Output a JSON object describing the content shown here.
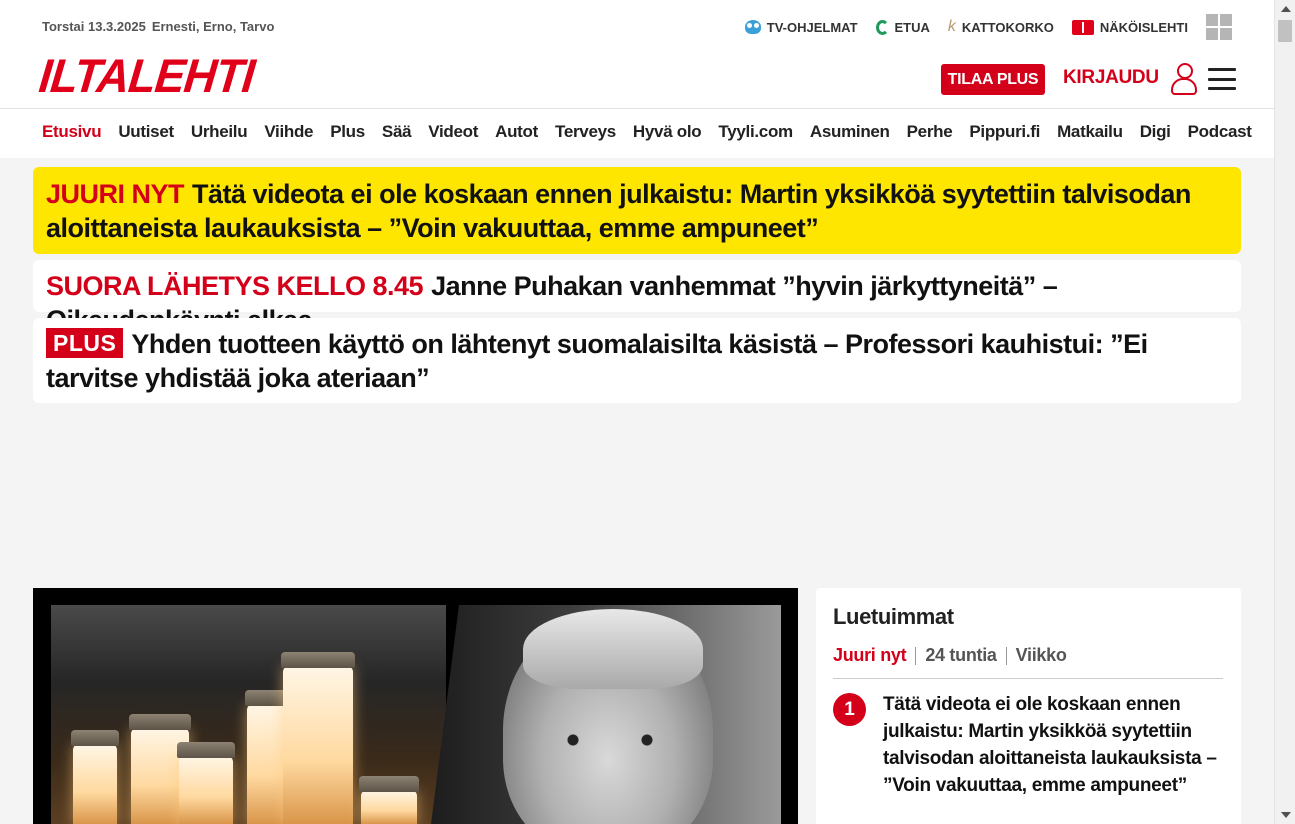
{
  "header": {
    "date": "Torstai 13.3.2025",
    "namedays": "Ernesti, Erno, Tarvo",
    "logo": "ILTALEHTI",
    "top_links": [
      {
        "label": "TV-OHJELMAT",
        "icon": "tv-guide-icon"
      },
      {
        "label": "ETUA",
        "icon": "etua-icon"
      },
      {
        "label": "KATTOKORKO",
        "icon": "kattokorko-icon"
      },
      {
        "label": "NÄKÖISLEHTI",
        "icon": "newspaper-icon"
      }
    ],
    "alma_logo": "alma-logo-icon",
    "subscribe_label": "TILAA PLUS",
    "login_label": "KIRJAUDU"
  },
  "nav": [
    "Etusivu",
    "Uutiset",
    "Urheilu",
    "Viihde",
    "Plus",
    "Sää",
    "Videot",
    "Autot",
    "Terveys",
    "Hyvä olo",
    "Tyyli.com",
    "Asuminen",
    "Perhe",
    "Pippuri.fi",
    "Matkailu",
    "Digi",
    "Podcast"
  ],
  "breaking": {
    "kicker": "JUURI NYT",
    "headline": "Tätä videota ei ole koskaan ennen julkaistu: Martin yksikköä syytettiin talvisodan aloittaneista laukauksista – ”Voin vakuuttaa, emme ampuneet”"
  },
  "live": {
    "kicker": "SUORA LÄHETYS KELLO 8.45",
    "headline": "Janne Puhakan vanhemmat ”hyvin järkyttyneitä” – Oikeudenkäynti alkaa"
  },
  "plus_story": {
    "badge": "PLUS",
    "headline": "Yhden tuotteen käyttö on lähtenyt suomalaisilta käsistä – Professori kauhistui: ”Ei tarvitse yhdistää joka ateriaan”"
  },
  "most_read": {
    "title": "Luetuimmat",
    "tabs": [
      "Juuri nyt",
      "24 tuntia",
      "Viikko"
    ],
    "items": [
      {
        "rank": "1",
        "text": "Tätä videota ei ole koskaan ennen julkaistu: Martin yksikköä syytettiin talvisodan aloittaneista laukauksista – ”Voin vakuuttaa, emme ampuneet”"
      }
    ]
  },
  "colors": {
    "brand_red": "#d4001a",
    "breaking_yellow": "#ffe600",
    "page_bg": "#f4f4f4"
  }
}
